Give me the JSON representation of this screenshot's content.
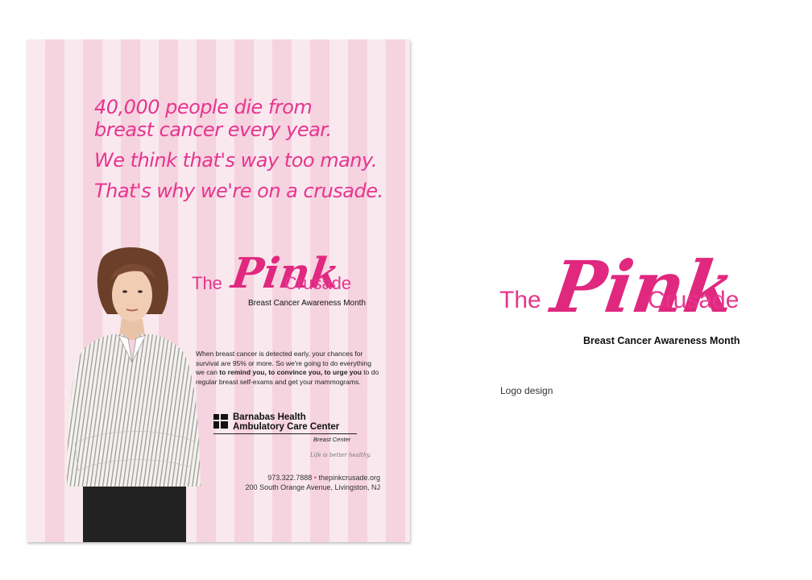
{
  "poster": {
    "headline": [
      "40,000 people die from",
      "breast cancer every year.",
      "We think that's way too many.",
      "That's why we're on a crusade."
    ],
    "logo": {
      "the": "The",
      "pink": "Pink",
      "crusade": "Crusade",
      "subtitle": "Breast Cancer Awareness Month"
    },
    "body": {
      "part1": "When breast cancer is detected early, your chances for survival are 95% or more. So we're going to do everything we can ",
      "bold1": "to remind you, to convince you, to urge you",
      "part2": " to do regular breast self-exams and get your mammograms."
    },
    "sponsor": {
      "line1": "Barnabas Health",
      "line2": "Ambulatory Care Center",
      "sub": "Breast Center",
      "tagline": "Life is better healthy."
    },
    "contact": {
      "phone": "973.322.7888",
      "separator": "•",
      "url": "thepinkcrusade.org",
      "address": "200 South Orange Avenue, Livingston, NJ"
    }
  },
  "logo_design": {
    "the": "The",
    "pink": "Pink",
    "crusade": "Crusade",
    "subtitle": "Breast Cancer Awareness Month",
    "caption": "Logo design"
  },
  "colors": {
    "brand_pink": "#e6358f",
    "stripe_light": "#f9e9ef",
    "stripe_dark": "#f5d3df"
  }
}
